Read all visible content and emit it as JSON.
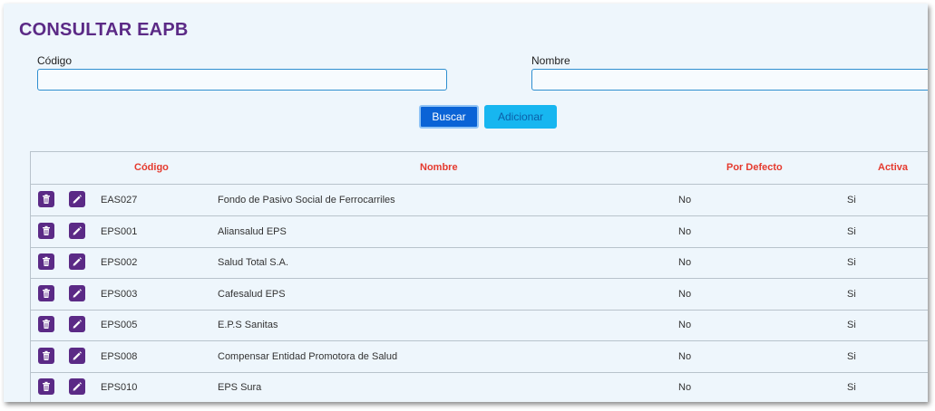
{
  "page": {
    "title": "CONSULTAR EAPB"
  },
  "search": {
    "codigo_label": "Código",
    "codigo_value": "",
    "nombre_label": "Nombre",
    "nombre_value": ""
  },
  "actions": {
    "buscar": "Buscar",
    "adicionar": "Adicionar"
  },
  "table": {
    "headers": {
      "codigo": "Código",
      "nombre": "Nombre",
      "por_defecto": "Por Defecto",
      "activa": "Activa"
    },
    "rows": [
      {
        "codigo": "EAS027",
        "nombre": "Fondo de Pasivo Social de Ferrocarriles",
        "por_defecto": "No",
        "activa": "Si"
      },
      {
        "codigo": "EPS001",
        "nombre": "Aliansalud EPS",
        "por_defecto": "No",
        "activa": "Si"
      },
      {
        "codigo": "EPS002",
        "nombre": "Salud Total S.A.",
        "por_defecto": "No",
        "activa": "Si"
      },
      {
        "codigo": "EPS003",
        "nombre": "Cafesalud EPS",
        "por_defecto": "No",
        "activa": "Si"
      },
      {
        "codigo": "EPS005",
        "nombre": "E.P.S Sanitas",
        "por_defecto": "No",
        "activa": "Si"
      },
      {
        "codigo": "EPS008",
        "nombre": "Compensar Entidad Promotora de Salud",
        "por_defecto": "No",
        "activa": "Si"
      },
      {
        "codigo": "EPS010",
        "nombre": "EPS Sura",
        "por_defecto": "No",
        "activa": "Si"
      }
    ]
  },
  "icons": {
    "delete": "trash-icon",
    "edit": "pencil-icon"
  },
  "colors": {
    "title": "#5b2a86",
    "header_text": "#e53a2e",
    "primary_button": "#0a63d6",
    "secondary_button": "#17b6f0",
    "action_icon_bg": "#5b2a86"
  }
}
